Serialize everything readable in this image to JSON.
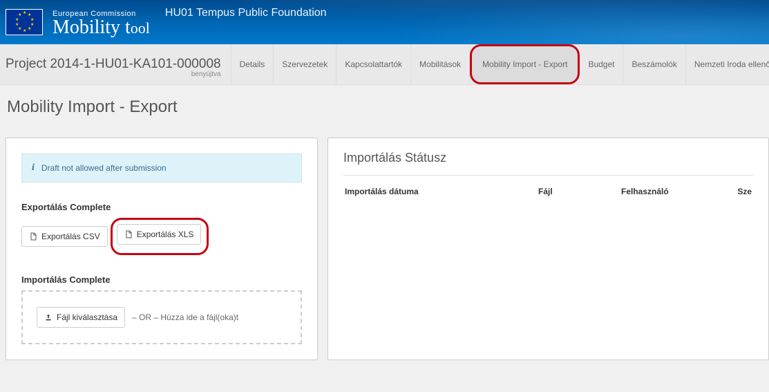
{
  "header": {
    "ec": "European Commission",
    "brand": "Mobility tool",
    "foundation": "HU01 Tempus Public Foundation"
  },
  "project": {
    "id": "Project 2014-1-HU01-KA101-000008",
    "status": "benyújtva"
  },
  "tabs": {
    "items": [
      {
        "label": "Details",
        "active": false
      },
      {
        "label": "Szervezetek",
        "active": false
      },
      {
        "label": "Kapcsolattartók",
        "active": false
      },
      {
        "label": "Mobilitások",
        "active": false
      },
      {
        "label": "Mobility Import - Export",
        "active": true,
        "highlight": true
      },
      {
        "label": "Budget",
        "active": false
      },
      {
        "label": "Beszámolók",
        "active": false
      },
      {
        "label": "Nemzeti Iroda ellenőrzése",
        "active": false
      }
    ]
  },
  "page": {
    "title": "Mobility Import - Export"
  },
  "left": {
    "alert": "Draft not allowed after submission",
    "export_label": "Exportálás Complete",
    "export_csv": "Exportálás CSV",
    "export_xls": "Exportálás XLS",
    "import_label": "Importálás Complete",
    "file_button": "Fájl kiválasztása",
    "drop_text": "– OR – Húzza ide a fájl(oka)t"
  },
  "right": {
    "title": "Importálás Státusz",
    "columns": {
      "date": "Importálás dátuma",
      "file": "Fájl",
      "user": "Felhasználó",
      "system": "Sze"
    }
  }
}
